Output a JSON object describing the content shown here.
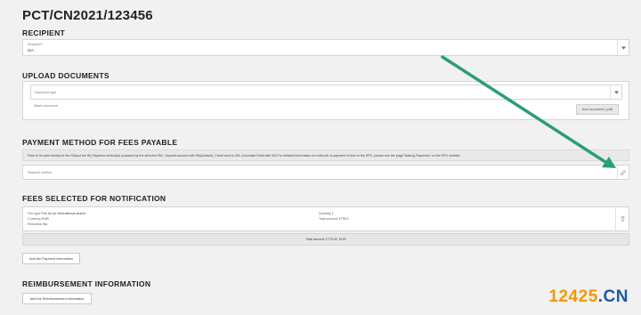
{
  "page_title": "PCT/CN2021/123456",
  "recipient": {
    "heading": "RECIPIENT",
    "label": "Recipient *",
    "value": "ISA"
  },
  "upload": {
    "heading": "UPLOAD DOCUMENTS",
    "doc_type_label": "Document type",
    "attach_label": "Attach document",
    "add_doc_button": "Add document (.pdf)"
  },
  "payment": {
    "heading": "PAYMENT METHOD FOR FEES PAYABLE",
    "info_text": "Fees to be paid directly to the ISA(not the IB) Payment method(s) accepted by the selected ISA : Deposit account with ISA(Default), Credit card to ISA, Automatic Debit with ISA For detailed information on methods of payment of fees to the EPO, please see the page 'Making Payments' on the EPO website.",
    "method_label": "Payment method"
  },
  "fees": {
    "heading": "FEES SELECTED FOR NOTIFICATION",
    "fee_type_key": "Fee type",
    "fee_type": "Fee for an international search",
    "currency_key": "Currency",
    "currency": "EUR",
    "reduction_key": "Reduction",
    "reduction": "No",
    "quantity_key": "Quantity",
    "quantity": "1",
    "total_key": "Total amount",
    "total": "1775.0",
    "total_amount_label": "Total amount",
    "total_amount": "1775.00",
    "total_currency": "EUR",
    "add_payment_button": "Add the Payment information"
  },
  "reimbursement": {
    "heading": "REIMBURSEMENT INFORMATION",
    "add_button": "Add the Reimbursement information"
  },
  "watermark": {
    "part1": "12425",
    "part2": ".CN"
  },
  "colors": {
    "arrow": "#2a9d78",
    "watermark_orange": "#f39800",
    "watermark_blue": "#1c5aa6"
  }
}
